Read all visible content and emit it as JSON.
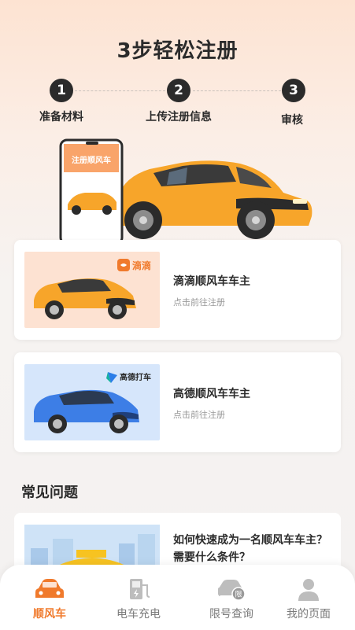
{
  "title": "3步轻松注册",
  "steps": [
    {
      "num": "1",
      "label": "准备材料"
    },
    {
      "num": "2",
      "label": "上传注册信息"
    },
    {
      "num": "3",
      "label": "审核"
    }
  ],
  "hero": {
    "phone_text": "注册顺风车"
  },
  "cards": [
    {
      "title": "滴滴顺风车车主",
      "subtitle": "点击前往注册",
      "brand": "滴滴"
    },
    {
      "title": "高德顺风车车主",
      "subtitle": "点击前往注册",
      "brand": "高德打车"
    }
  ],
  "faq": {
    "section_title": "常见问题",
    "items": [
      {
        "question": "如何快速成为一名顺风车车主？需要什么条件？"
      }
    ]
  },
  "tabbar": {
    "items": [
      {
        "label": "顺风车",
        "icon": "car-icon",
        "active": true
      },
      {
        "label": "电车充电",
        "icon": "charger-icon",
        "active": false
      },
      {
        "label": "限号查询",
        "icon": "restricted-car-icon",
        "active": false
      },
      {
        "label": "我的页面",
        "icon": "user-icon",
        "active": false
      }
    ]
  },
  "colors": {
    "accent": "#f07a2c",
    "orange_car": "#f7a52a",
    "blue_car": "#3d7ee6"
  }
}
